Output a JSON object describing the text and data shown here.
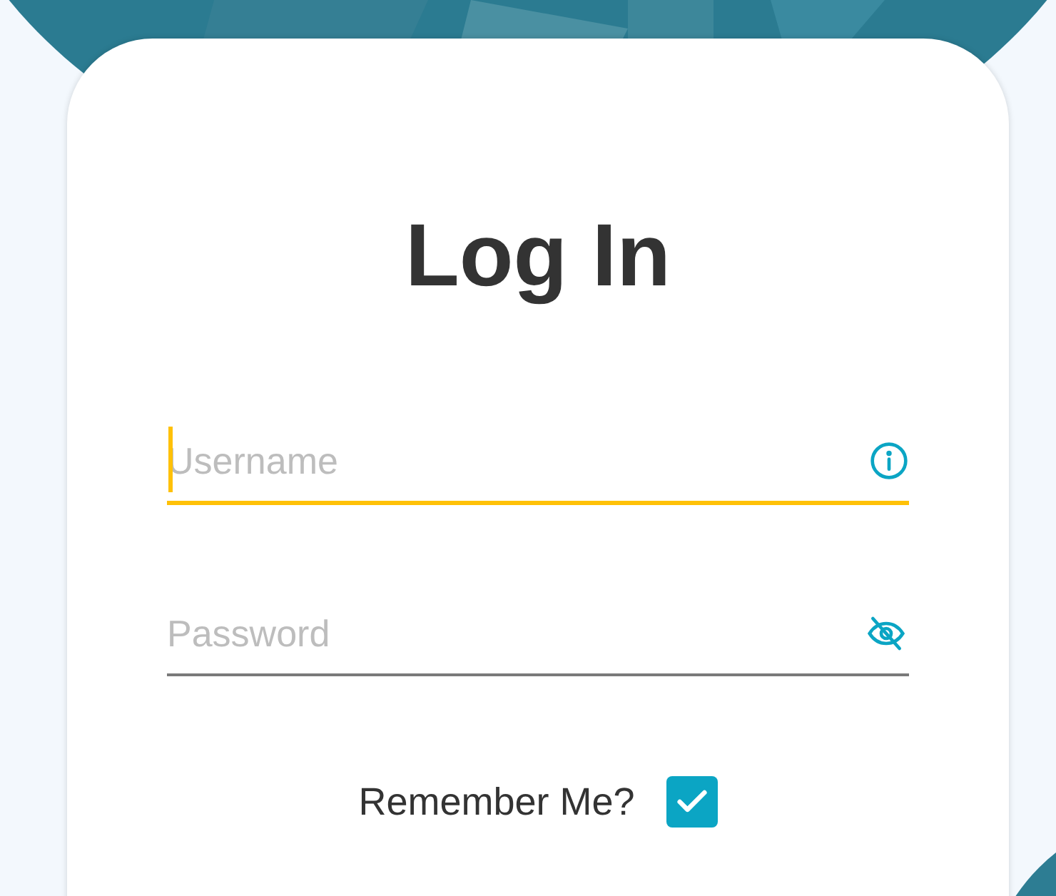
{
  "title": "Log In",
  "fields": [
    {
      "kind": "username",
      "placeholder": "Username",
      "focused": true
    },
    {
      "kind": "password",
      "placeholder": "Password",
      "focused": false
    }
  ],
  "remember": {
    "label": "Remember Me?",
    "checked": true
  }
}
